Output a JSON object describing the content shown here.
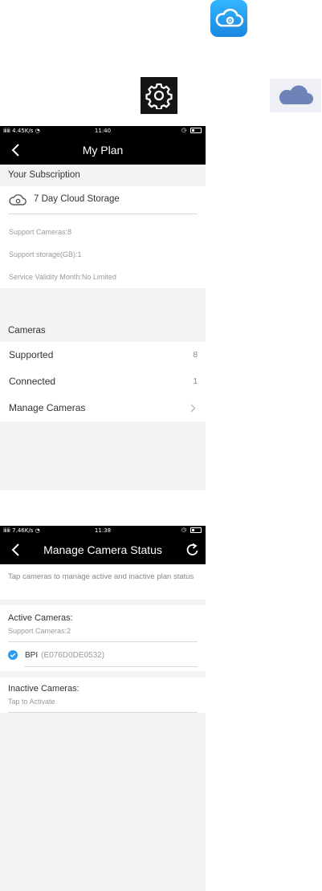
{
  "colors": {
    "accent": "#2b9cf0",
    "nav_bg": "#000000",
    "page_bg": "#f3f3f4"
  },
  "icons": {
    "app": "cloud-eye-app-icon",
    "settings": "gear-icon",
    "cloud": "cloud-icon"
  },
  "plan_screen": {
    "status": {
      "left": "4.45K/s",
      "time": "11:40"
    },
    "title": "My Plan",
    "subscription_header": "Your Subscription",
    "plan_name": "7 Day Cloud Storage",
    "details": [
      "Support Cameras:8",
      "Support storage(GB):1",
      "Service Validity Month:No Limited"
    ],
    "cameras_header": "Cameras",
    "rows": {
      "supported": {
        "label": "Supported",
        "value": "8"
      },
      "connected": {
        "label": "Connected",
        "value": "1"
      },
      "manage": {
        "label": "Manage Cameras"
      }
    }
  },
  "status_screen": {
    "status": {
      "left": "7.46K/s",
      "time": "11:38"
    },
    "title": "Manage Camera Status",
    "instruction": "Tap cameras to manage active and inactive plan status",
    "active": {
      "title": "Active Cameras:",
      "subtitle": "Support Cameras:2"
    },
    "camera": {
      "name": "BPI",
      "id": "(E076D0DE0532)"
    },
    "inactive": {
      "title": "Inactive Cameras:",
      "subtitle": "Tap to Activate"
    }
  }
}
